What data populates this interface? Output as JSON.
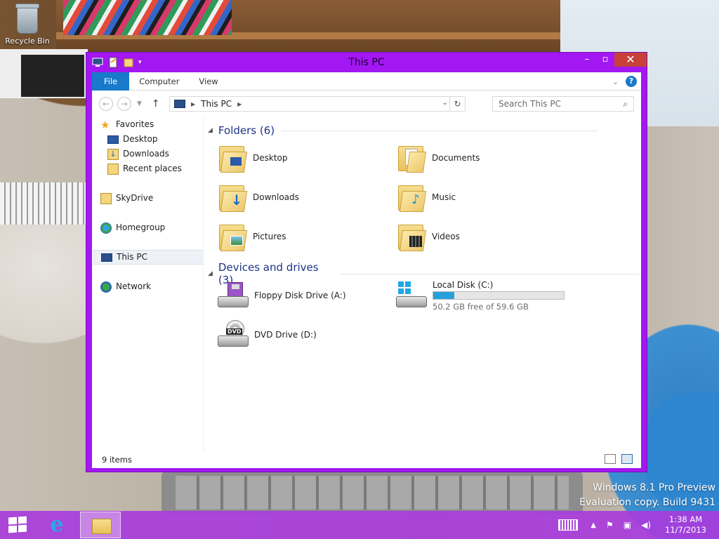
{
  "desktop": {
    "recycle_bin_label": "Recycle Bin",
    "watermark_line1": "Windows 8.1 Pro Preview",
    "watermark_line2": "Evaluation copy. Build 9431"
  },
  "window": {
    "title": "This PC",
    "accent_color": "#a317f2",
    "ribbon_tabs": [
      {
        "label": "File"
      },
      {
        "label": "Computer"
      },
      {
        "label": "View"
      }
    ],
    "help_label": "?",
    "address": {
      "location": "This PC"
    },
    "search": {
      "placeholder": "Search This PC"
    },
    "navigation": [
      {
        "label": "Favorites",
        "icon": "star-icon"
      },
      {
        "label": "Desktop",
        "icon": "desktop-icon"
      },
      {
        "label": "Downloads",
        "icon": "downloads-icon"
      },
      {
        "label": "Recent places",
        "icon": "recent-places-icon"
      },
      {
        "label": "SkyDrive",
        "icon": "skydrive-icon"
      },
      {
        "label": "Homegroup",
        "icon": "homegroup-icon"
      },
      {
        "label": "This PC",
        "icon": "computer-icon"
      },
      {
        "label": "Network",
        "icon": "network-icon"
      }
    ],
    "folders_group": {
      "label": "Folders (6)",
      "items": [
        {
          "label": "Desktop",
          "icon": "desktop-folder-icon"
        },
        {
          "label": "Documents",
          "icon": "documents-folder-icon"
        },
        {
          "label": "Downloads",
          "icon": "downloads-folder-icon"
        },
        {
          "label": "Music",
          "icon": "music-folder-icon"
        },
        {
          "label": "Pictures",
          "icon": "pictures-folder-icon"
        },
        {
          "label": "Videos",
          "icon": "videos-folder-icon"
        }
      ]
    },
    "devices_group": {
      "label": "Devices and drives (3)",
      "items": [
        {
          "label": "Floppy Disk Drive (A:)",
          "icon": "floppy-drive-icon"
        },
        {
          "label": "Local Disk (C:)",
          "icon": "local-disk-icon",
          "free_text": "50.2 GB free of 59.6 GB",
          "used_fraction": 0.16
        },
        {
          "label": "DVD Drive (D:)",
          "icon": "dvd-drive-icon",
          "badge": "DVD"
        }
      ]
    },
    "status": {
      "items_count": "9 items"
    }
  },
  "taskbar": {
    "color": "#a83cdc",
    "clock_time": "1:38 AM",
    "clock_date": "11/7/2013"
  }
}
